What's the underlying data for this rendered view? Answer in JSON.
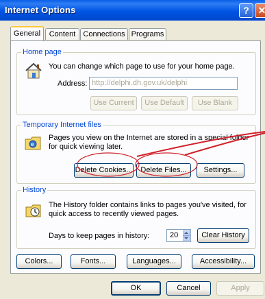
{
  "window": {
    "title": "Internet Options"
  },
  "titlebar": {
    "help_glyph": "?",
    "close_glyph": "✕"
  },
  "tabs": [
    {
      "label": "General",
      "active": true
    },
    {
      "label": "Content",
      "active": false
    },
    {
      "label": "Connections",
      "active": false
    },
    {
      "label": "Programs",
      "active": false
    }
  ],
  "home_page": {
    "title": "Home page",
    "description": "You can change which page to use for your home page.",
    "address_label": "Address:",
    "address_value": "http://delphi.dh.gov.uk/delphi",
    "use_current": "Use Current",
    "use_default": "Use Default",
    "use_blank": "Use Blank"
  },
  "temp_files": {
    "title": "Temporary Internet files",
    "line1": "Pages you view on the Internet are stored in a special folder",
    "line2": "for quick viewing later.",
    "delete_cookies": "Delete Cookies...",
    "delete_files": "Delete Files...",
    "settings": "Settings..."
  },
  "history": {
    "title": "History",
    "line1": "The History folder contains links to pages you've visited, for",
    "line2": "quick access to recently viewed pages.",
    "days_label": "Days to keep pages in history:",
    "days_value": "20",
    "clear_history": "Clear History"
  },
  "bottom_row": {
    "colors": "Colors...",
    "fonts": "Fonts...",
    "languages": "Languages...",
    "accessibility": "Accessibility..."
  },
  "dialog_buttons": {
    "ok": "OK",
    "cancel": "Cancel",
    "apply": "Apply"
  },
  "annotation": {
    "color": "#d0202a"
  }
}
